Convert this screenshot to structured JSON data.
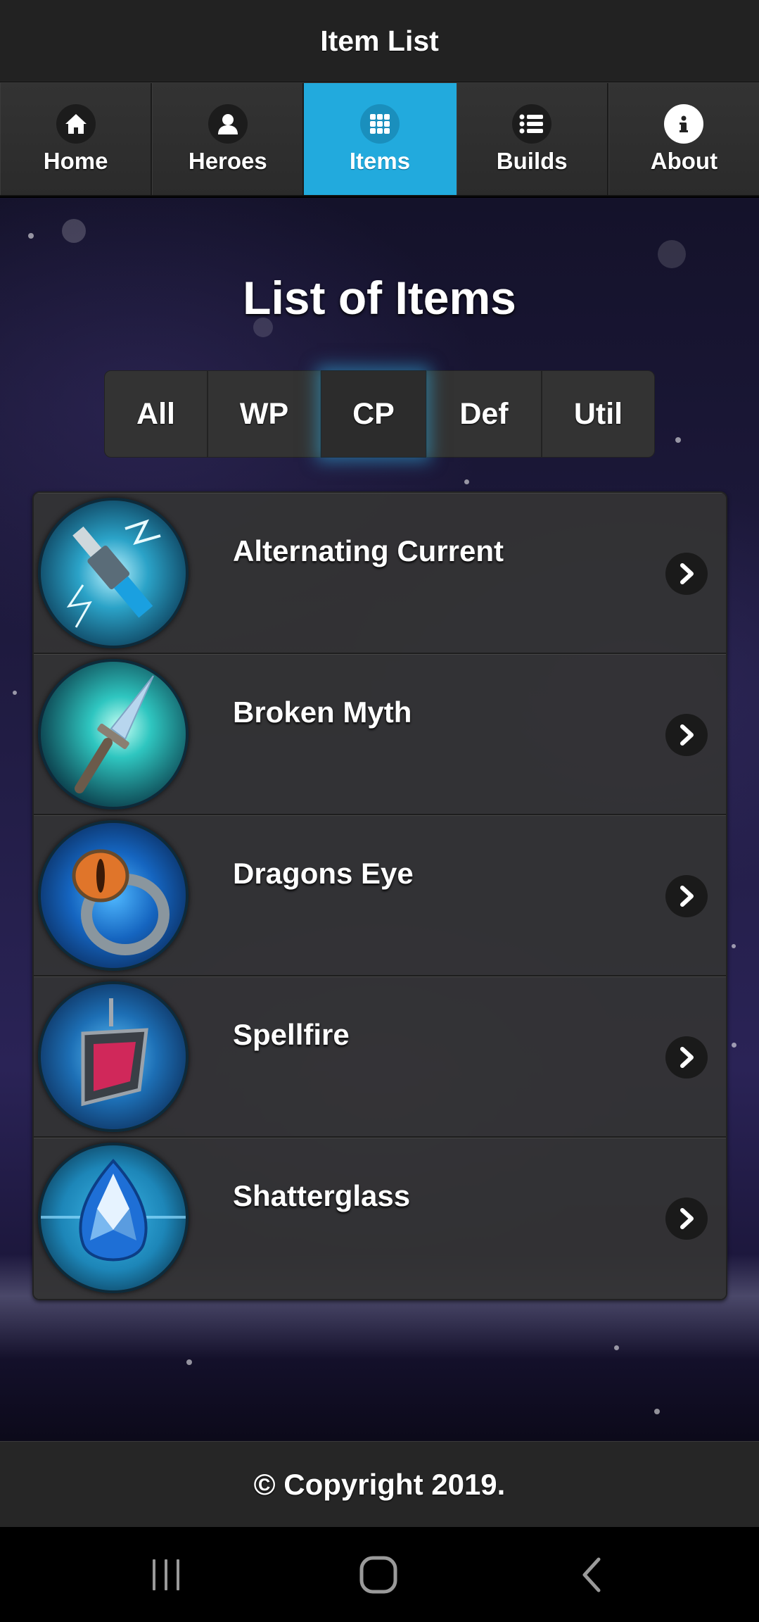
{
  "header": {
    "title": "Item List"
  },
  "nav": {
    "items": [
      {
        "label": "Home",
        "icon": "home-icon",
        "active": false
      },
      {
        "label": "Heroes",
        "icon": "user-icon",
        "active": false
      },
      {
        "label": "Items",
        "icon": "grid-icon",
        "active": true
      },
      {
        "label": "Builds",
        "icon": "list-icon",
        "active": false
      },
      {
        "label": "About",
        "icon": "info-icon",
        "active": false
      }
    ]
  },
  "main": {
    "title": "List of Items",
    "filters": [
      {
        "label": "All",
        "active": false
      },
      {
        "label": "WP",
        "active": false
      },
      {
        "label": "CP",
        "active": true
      },
      {
        "label": "Def",
        "active": false
      },
      {
        "label": "Util",
        "active": false
      }
    ],
    "items": [
      {
        "name": "Alternating Current",
        "icon": "spark-plug-icon"
      },
      {
        "name": "Broken Myth",
        "icon": "dagger-icon"
      },
      {
        "name": "Dragons Eye",
        "icon": "ring-icon"
      },
      {
        "name": "Spellfire",
        "icon": "amulet-icon"
      },
      {
        "name": "Shatterglass",
        "icon": "crystal-icon"
      }
    ]
  },
  "footer": {
    "text": "© Copyright 2019."
  },
  "colors": {
    "accent": "#22aadd",
    "header_bg": "#222222",
    "list_bg": "#343434"
  },
  "system_nav": {
    "icons": [
      "recent-apps-icon",
      "home-circle-icon",
      "back-icon"
    ]
  }
}
